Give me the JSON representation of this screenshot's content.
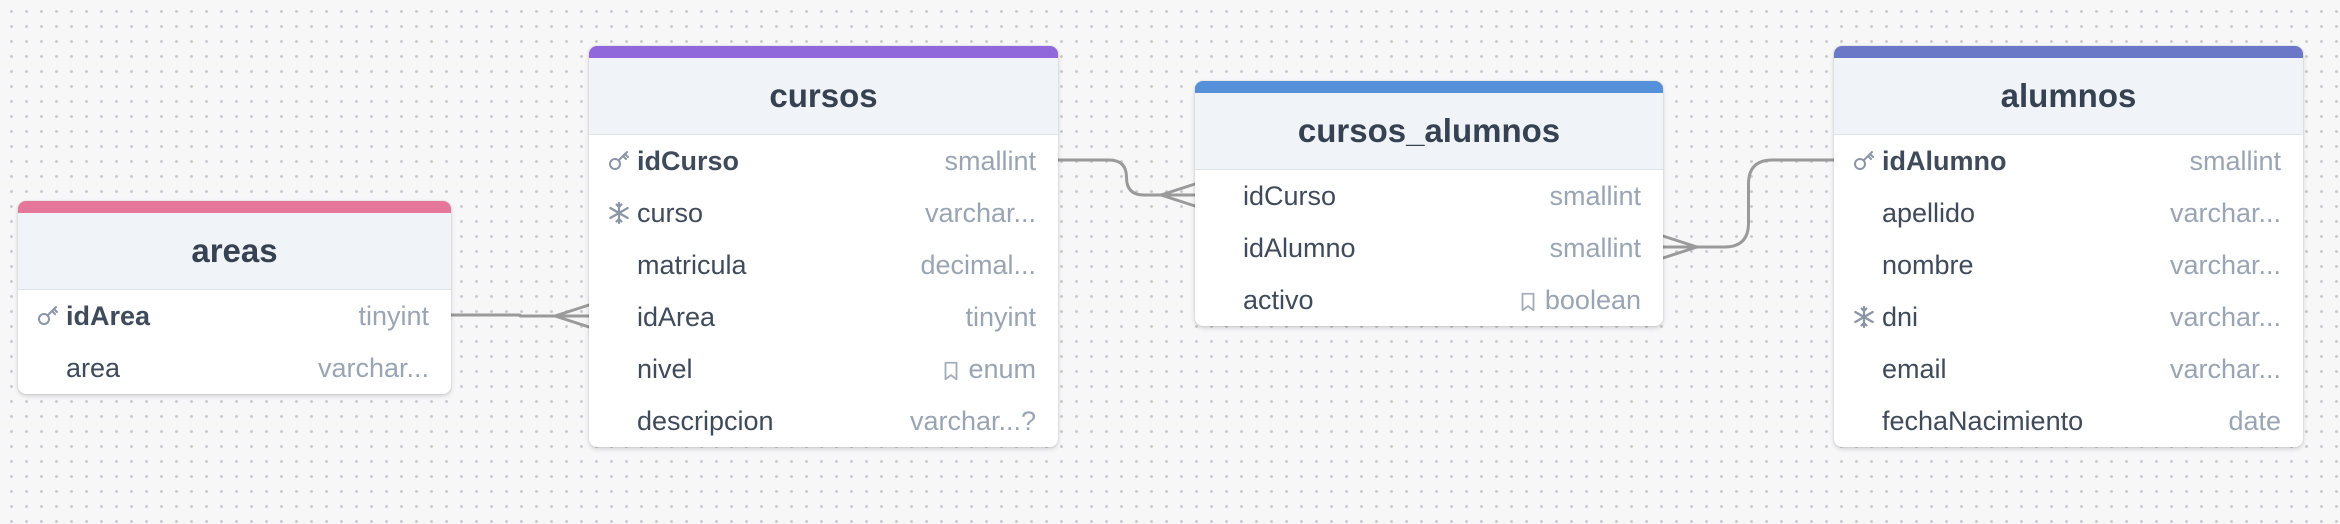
{
  "colors": {
    "areas": "#e5779a",
    "cursos": "#9068dc",
    "cursos_alumnos": "#5591db",
    "alumnos": "#6b78c8",
    "connector": "#9a9a9a"
  },
  "tables": [
    {
      "id": "areas",
      "name": "areas",
      "color": "#e5779a",
      "fields": [
        {
          "name": "idArea",
          "type": "tinyint",
          "icon": "key-icon"
        },
        {
          "name": "area",
          "type": "varchar...",
          "icon": ""
        }
      ]
    },
    {
      "id": "cursos",
      "name": "cursos",
      "color": "#9068dc",
      "fields": [
        {
          "name": "idCurso",
          "type": "smallint",
          "icon": "key-icon"
        },
        {
          "name": "curso",
          "type": "varchar...",
          "icon": "snowflake-icon"
        },
        {
          "name": "matricula",
          "type": "decimal...",
          "icon": ""
        },
        {
          "name": "idArea",
          "type": "tinyint",
          "icon": ""
        },
        {
          "name": "nivel",
          "type": "enum",
          "icon": "",
          "type_icon": "bookmark-icon"
        },
        {
          "name": "descripcion",
          "type": "varchar...?",
          "icon": ""
        }
      ]
    },
    {
      "id": "cursos_alumnos",
      "name": "cursos_alumnos",
      "color": "#5591db",
      "fields": [
        {
          "name": "idCurso",
          "type": "smallint",
          "icon": ""
        },
        {
          "name": "idAlumno",
          "type": "smallint",
          "icon": ""
        },
        {
          "name": "activo",
          "type": "boolean",
          "icon": "",
          "type_icon": "bookmark-icon"
        }
      ]
    },
    {
      "id": "alumnos",
      "name": "alumnos",
      "color": "#6b78c8",
      "fields": [
        {
          "name": "idAlumno",
          "type": "smallint",
          "icon": "key-icon"
        },
        {
          "name": "apellido",
          "type": "varchar...",
          "icon": ""
        },
        {
          "name": "nombre",
          "type": "varchar...",
          "icon": ""
        },
        {
          "name": "dni",
          "type": "varchar...",
          "icon": "snowflake-icon"
        },
        {
          "name": "email",
          "type": "varchar...",
          "icon": ""
        },
        {
          "name": "fechaNacimiento",
          "type": "date",
          "icon": ""
        }
      ]
    }
  ],
  "relations": [
    {
      "from_table": "areas",
      "from_field": "idArea",
      "to_table": "cursos",
      "to_field": "idArea",
      "cardinality": "one-to-many"
    },
    {
      "from_table": "cursos",
      "from_field": "idCurso",
      "to_table": "cursos_alumnos",
      "to_field": "idCurso",
      "cardinality": "one-to-many"
    },
    {
      "from_table": "alumnos",
      "from_field": "idAlumno",
      "to_table": "cursos_alumnos",
      "to_field": "idAlumno",
      "cardinality": "one-to-many"
    }
  ]
}
